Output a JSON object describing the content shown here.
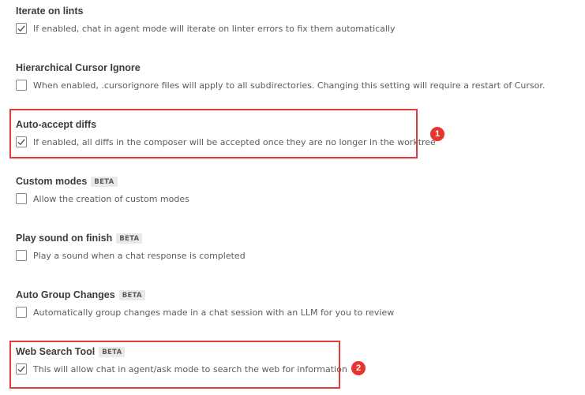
{
  "settings": [
    {
      "title": "Iterate on lints",
      "badge": "",
      "checked": true,
      "description": "If enabled, chat in agent mode will iterate on linter errors to fix them automatically"
    },
    {
      "title": "Hierarchical Cursor Ignore",
      "badge": "",
      "checked": false,
      "description": "When enabled, .cursorignore files will apply to all subdirectories. Changing this setting will require a restart of Cursor."
    },
    {
      "title": "Auto-accept diffs",
      "badge": "",
      "checked": true,
      "description": "If enabled, all diffs in the composer will be accepted once they are no longer in the worktree"
    },
    {
      "title": "Custom modes",
      "badge": "BETA",
      "checked": false,
      "description": "Allow the creation of custom modes"
    },
    {
      "title": "Play sound on finish",
      "badge": "BETA",
      "checked": false,
      "description": "Play a sound when a chat response is completed"
    },
    {
      "title": "Auto Group Changes",
      "badge": "BETA",
      "checked": false,
      "description": "Automatically group changes made in a chat session with an LLM for you to review"
    },
    {
      "title": "Web Search Tool",
      "badge": "BETA",
      "checked": true,
      "description": "This will allow chat in agent/ask mode to search the web for information"
    }
  ],
  "annotations": [
    {
      "label": "1"
    },
    {
      "label": "2"
    }
  ],
  "colors": {
    "highlight": "#e23a3a",
    "marker": "#e8332f"
  }
}
